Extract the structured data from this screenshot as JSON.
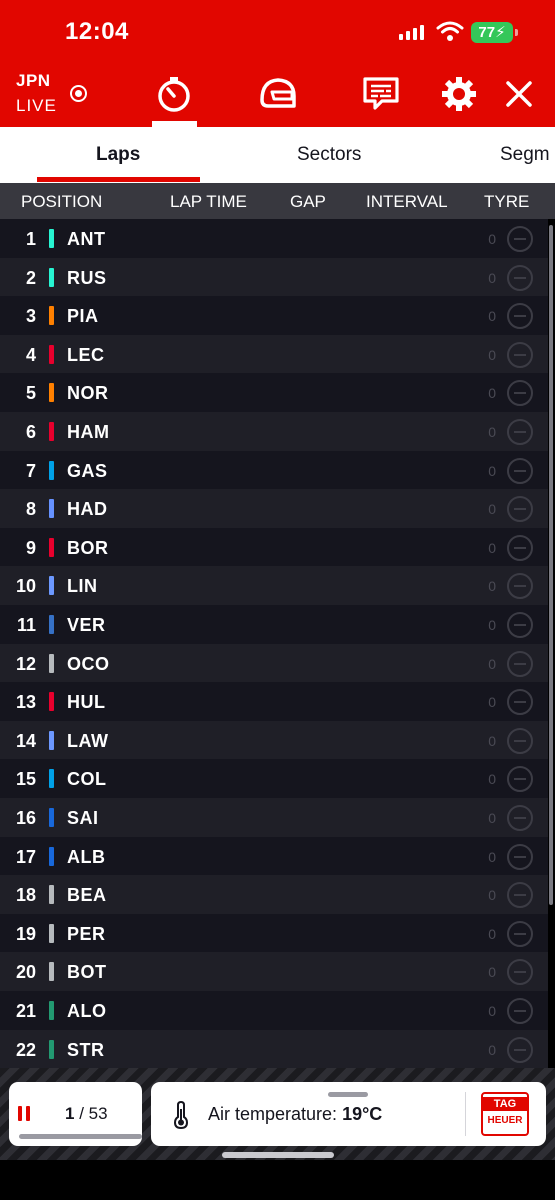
{
  "status_bar": {
    "time": "12:04",
    "battery": "77"
  },
  "header": {
    "event_code": "JPN",
    "live_label": "LIVE",
    "icons": [
      "timer-icon",
      "helmet-icon",
      "race-control-icon",
      "settings-icon",
      "close-icon"
    ]
  },
  "tabs": [
    {
      "label": "Laps",
      "active": true
    },
    {
      "label": "Sectors",
      "active": false
    },
    {
      "label": "Segm",
      "active": false
    }
  ],
  "table": {
    "columns": [
      "POSITION",
      "LAP TIME",
      "GAP",
      "INTERVAL",
      "TYRE"
    ],
    "rows": [
      {
        "pos": "1",
        "code": "ANT",
        "color": "#27f4d2",
        "laps": "0"
      },
      {
        "pos": "2",
        "code": "RUS",
        "color": "#27f4d2",
        "laps": "0"
      },
      {
        "pos": "3",
        "code": "PIA",
        "color": "#ff8000",
        "laps": "0"
      },
      {
        "pos": "4",
        "code": "LEC",
        "color": "#e8002d",
        "laps": "0"
      },
      {
        "pos": "5",
        "code": "NOR",
        "color": "#ff8000",
        "laps": "0"
      },
      {
        "pos": "6",
        "code": "HAM",
        "color": "#e8002d",
        "laps": "0"
      },
      {
        "pos": "7",
        "code": "GAS",
        "color": "#00a1e8",
        "laps": "0"
      },
      {
        "pos": "8",
        "code": "HAD",
        "color": "#6692ff",
        "laps": "0"
      },
      {
        "pos": "9",
        "code": "BOR",
        "color": "#e8002d",
        "laps": "0"
      },
      {
        "pos": "10",
        "code": "LIN",
        "color": "#6c98ff",
        "laps": "0"
      },
      {
        "pos": "11",
        "code": "VER",
        "color": "#3671c6",
        "laps": "0"
      },
      {
        "pos": "12",
        "code": "OCO",
        "color": "#b6babd",
        "laps": "0"
      },
      {
        "pos": "13",
        "code": "HUL",
        "color": "#e8002d",
        "laps": "0"
      },
      {
        "pos": "14",
        "code": "LAW",
        "color": "#6c98ff",
        "laps": "0"
      },
      {
        "pos": "15",
        "code": "COL",
        "color": "#00a1e8",
        "laps": "0"
      },
      {
        "pos": "16",
        "code": "SAI",
        "color": "#1868db",
        "laps": "0"
      },
      {
        "pos": "17",
        "code": "ALB",
        "color": "#1868db",
        "laps": "0"
      },
      {
        "pos": "18",
        "code": "BEA",
        "color": "#b6babd",
        "laps": "0"
      },
      {
        "pos": "19",
        "code": "PER",
        "color": "#b6babd",
        "laps": "0"
      },
      {
        "pos": "20",
        "code": "BOT",
        "color": "#b6babd",
        "laps": "0"
      },
      {
        "pos": "21",
        "code": "ALO",
        "color": "#229971",
        "laps": "0"
      },
      {
        "pos": "22",
        "code": "STR",
        "color": "#229971",
        "laps": "0"
      }
    ]
  },
  "footer": {
    "current_lap": "1",
    "separator": "/",
    "total_laps": "53",
    "air_temp_label": "Air temperature:",
    "air_temp_value": "19°C",
    "sponsor_line1": "TAG",
    "sponsor_line2": "HEUER"
  },
  "colors": {
    "accent": "#e10600",
    "row_dark": "#15151e",
    "row_light": "#1f1f27",
    "header_row": "#38383f"
  }
}
